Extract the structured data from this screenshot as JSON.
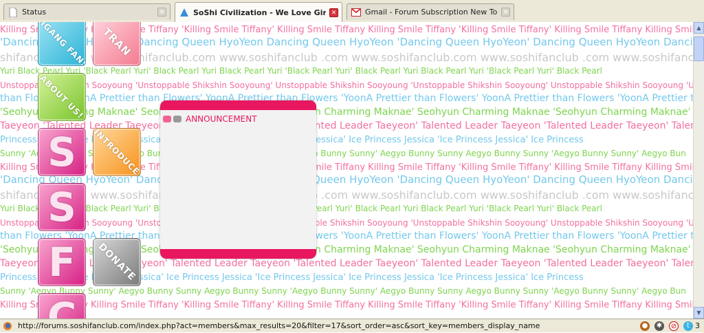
{
  "tabs": [
    {
      "label": "Status",
      "icon": "page-icon",
      "active": false
    },
    {
      "label": "SoShi Civilization - We Love Girls'...",
      "icon": "soshi-favicon-icon",
      "active": true
    },
    {
      "label": "Gmail - Forum Subscription New Topic N...",
      "icon": "gmail-icon",
      "active": false
    }
  ],
  "background_phrases": {
    "r1": "Killing Smile Tiffany Killing Smile Tiffany 'Killing Smile Tiffany' Killing Smile Tiffany Killing Smile Tiffany 'Killing Smile Tiffany' Killing Smile Tiffany Killing Smile Tiffany 'Killing Smile Tiffany' Killing",
    "r2": "'Dancing Queen HyoYeon' Dancing Queen HyoYeon Dancing Queen HyoYeon 'Dancing Queen HyoYeon' Dancing Queen HyoYeon Dancing Queen HyoYeon 'Dancing Queen HyoYeon' Dancing",
    "r3": "shifanclub .com www.soshifanclub.com www.soshifanclub .com www.soshifanclub.com www.soshifanclub .com www.soshifanclub.com www.soshifanclub .com",
    "r4": "Yuri Black Pearl Yuri 'Black Pearl Yuri' Black Pearl Yuri Black Pearl Yuri 'Black Pearl Yuri' Black Pearl Yuri Black Pearl Yuri 'Black Pearl Yuri' Black Pearl",
    "r5": "Unstoppable Shikshin Sooyoung 'Unstoppable Shikshin Sooyoung' Unstoppable Shikshin Sooyoung 'Unstoppable Shikshin Sooyoung' Unstoppable Shikshin Sooyoung 'Unstoppable Shikshin Sooyoung'",
    "r6": "than Flowers 'YoonA Prettier than Flowers' YoonA Prettier than Flowers 'YoonA Prettier than Flowers' YoonA Prettier than Flowers 'YoonA Prettier than Flowers' YoonA Prettier than Flowers 'YoonA",
    "r7": "'Seohyun Charming Maknae' Seohyun Charming Maknae 'Seohyun Charming Maknae' Seohyun Charming Maknae 'Seohyun Charming Maknae' Seohyun Cha",
    "r8": "Taeyeon 'Talented Leader Taeyeon' Talented Leader Taeyeon 'Talented Leader Taeyeon' Talented Leader Taeyeon 'Talented Leader Taeyeon' Talented",
    "r9": "Princess Jessica 'Ice Princess Jessica' Ice Princess Jessica 'Ice Princess Jessica' Ice Princess Jessica 'Ice Princess Jessica' Ice Princess",
    "r10": "Sunny 'Aegyo Bunny Sunny' Aegyo Bunny Sunny Aegyo Bunny Sunny 'Aegyo Bunny Sunny' Aegyo Bunny Sunny Aegyo Bunny Sunny 'Aegyo Bunny Sunny' Aegyo Bun"
  },
  "side_buttons": {
    "fansubs": "SOSHIGANG FANSUBS",
    "tran": "TRAN",
    "about": "ABOUT US!",
    "introduce": "INTRODUCE",
    "donate": "DONATE",
    "letters": [
      "S",
      "S",
      "F",
      "C"
    ]
  },
  "announcement": {
    "title": "ANNOUNCEMENT"
  },
  "statusbar": {
    "url": "http://forums.soshifanclub.com/index.php?act=members&max_results=20&filter=17&sort_order=asc&sort_key=members_display_name",
    "count": "3"
  },
  "colors": {
    "pink": "#e8175f",
    "tiffany": "#f26fa1",
    "hyoyeon": "#73c8ec",
    "yuri": "#7ed44e",
    "tab_close_active": "#d8333a"
  }
}
